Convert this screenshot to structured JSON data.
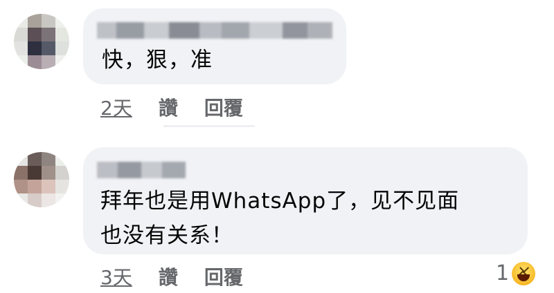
{
  "comments": [
    {
      "author": "",
      "text": "快，狠，准",
      "time": "2天",
      "like_label": "讚",
      "reply_label": "回覆"
    },
    {
      "author": "",
      "text": "拜年也是用WhatsApp了，见不见面\n也没有关系！",
      "time": "3天",
      "like_label": "讚",
      "reply_label": "回覆",
      "reaction": {
        "count": "1",
        "icon": "haha-emoji-icon"
      }
    }
  ],
  "colors": {
    "bubble": "#f0f2f5",
    "meta_text": "#65676b",
    "body_text": "#050505",
    "reaction_yellow": "#f7b928"
  }
}
